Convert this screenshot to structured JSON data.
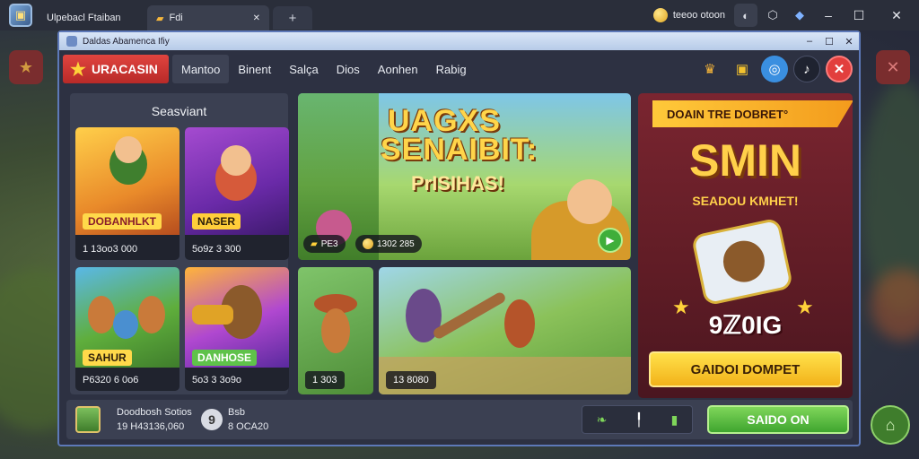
{
  "os": {
    "tab1_label": "Ulpebacl Ftaiban",
    "tab2_label": "Fdi",
    "tab2_close": "✕",
    "newtab": "+",
    "coin_text": "teeoo otoon",
    "win_min": "–",
    "win_max": "☐",
    "win_close": "✕"
  },
  "window": {
    "title": "Daldas Abamenca Ifiy",
    "ctrl_min": "–",
    "ctrl_max": "☐",
    "ctrl_close": "✕"
  },
  "nav": {
    "brand": "URACASIN",
    "items": [
      "Mantoo",
      "Binent",
      "Salça",
      "Dios",
      "Aonhen",
      "Rabig"
    ]
  },
  "left_panel": {
    "title": "Seasviant",
    "cards": [
      {
        "label": "DOBANHLKT",
        "price": "1 13oo3 000"
      },
      {
        "label": "NASER",
        "price": "5o9z 3 300"
      },
      {
        "label": "SAHUR",
        "price": "P6320 6 0o6"
      },
      {
        "label": "DANHOSE",
        "price": "5o3 3 3o9o"
      }
    ]
  },
  "banner": {
    "line1": "UAGXS",
    "line2": "SENAIBIT:",
    "line3": "PrISIHAS!",
    "chip1": "PE3",
    "chip2": "1302 285"
  },
  "scenes": [
    {
      "price": "1 303"
    },
    {
      "price": "13 8080"
    }
  ],
  "promo": {
    "ribbon": "DOAIN TRE DOBRET°",
    "big": "SMIN",
    "sub": "SEADOU KMHET!",
    "amount": "9ℤ0IG",
    "button": "GAIDOI DOMPET"
  },
  "bottom": {
    "line1": "Doodbosh Sotios",
    "line2": "19 H43136,060",
    "coin_glyph": "9",
    "line3": "Bsb",
    "line4": "8 OCA20",
    "claim": "SAIDO ON"
  }
}
